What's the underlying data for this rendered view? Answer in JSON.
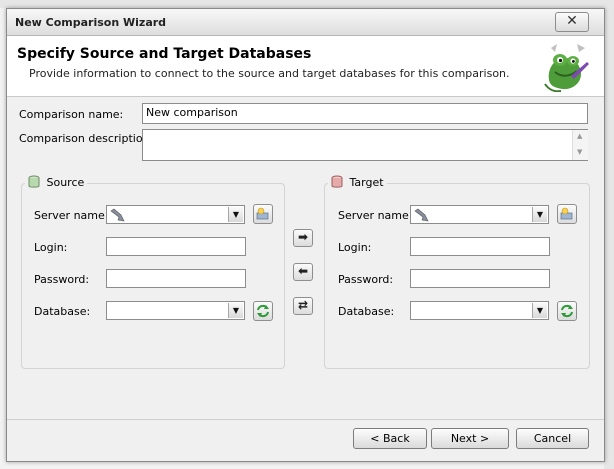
{
  "window": {
    "title": "New Comparison Wizard",
    "close": "✕"
  },
  "header": {
    "title": "Specify Source and Target Databases",
    "subtitle": "Provide information to connect to the source and target databases for this comparison."
  },
  "comparison": {
    "name_label": "Comparison name:",
    "name_value": "New comparison",
    "desc_label": "Comparison description:",
    "desc_value": ""
  },
  "source": {
    "title": "Source",
    "server_label": "Server name:",
    "server_value": "",
    "login_label": "Login:",
    "login_value": "",
    "password_label": "Password:",
    "password_value": "",
    "database_label": "Database:",
    "database_value": ""
  },
  "target": {
    "title": "Target",
    "server_label": "Server name:",
    "server_value": "",
    "login_label": "Login:",
    "login_value": "",
    "password_label": "Password:",
    "password_value": "",
    "database_label": "Database:",
    "database_value": ""
  },
  "middle": {
    "copy_right": "➡",
    "copy_left": "⬅",
    "swap": "⇄"
  },
  "footer": {
    "back": "< Back",
    "next": "Next >",
    "cancel": "Cancel"
  }
}
